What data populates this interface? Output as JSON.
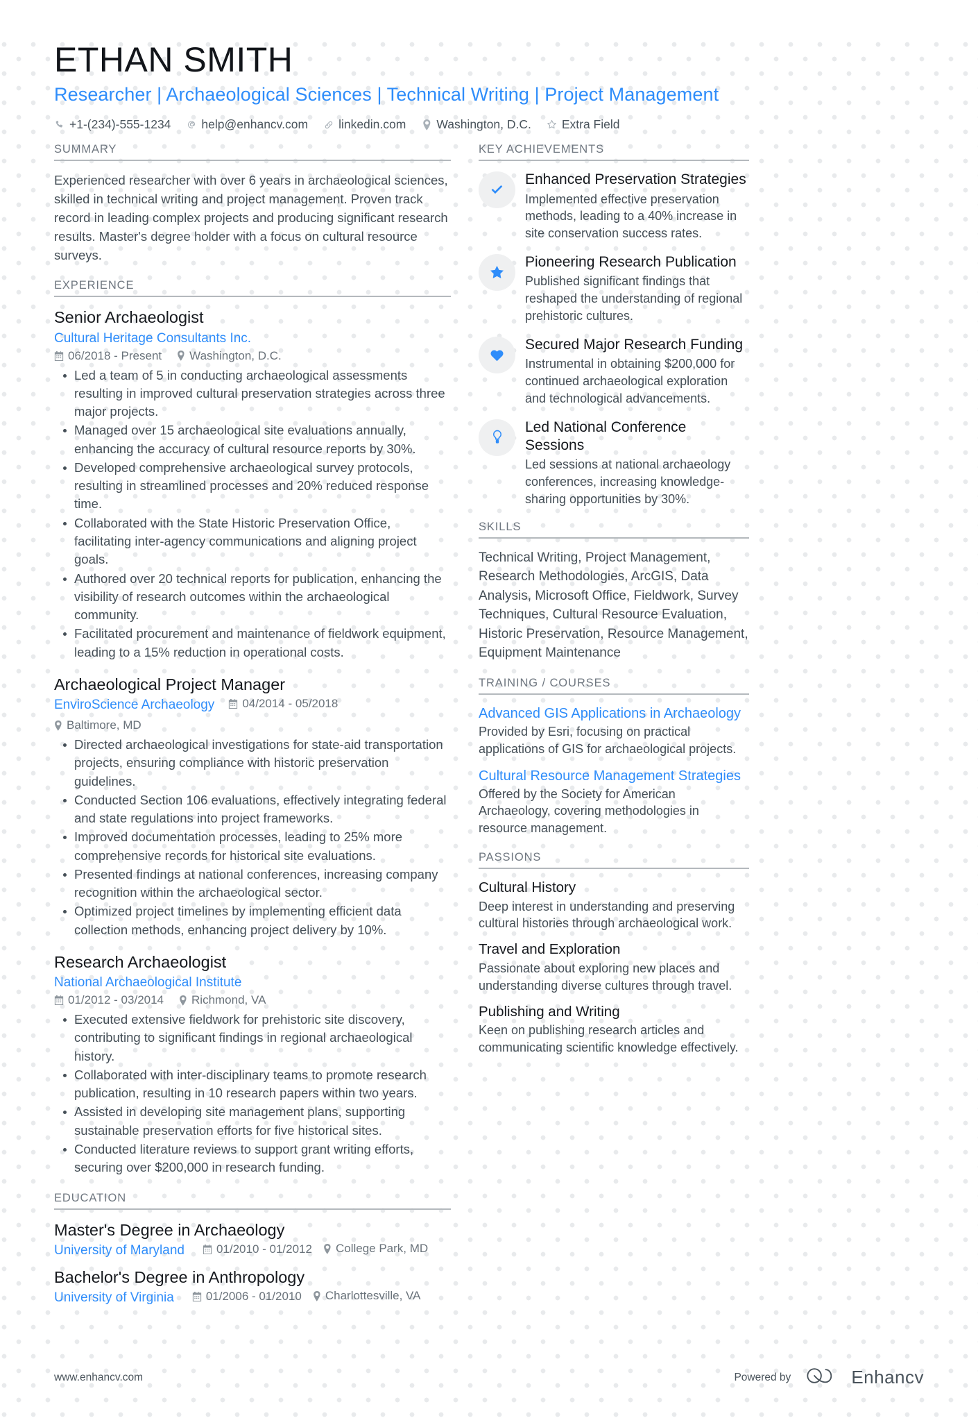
{
  "header": {
    "name": "ETHAN SMITH",
    "headline": "Researcher | Archaeological Sciences | Technical Writing | Project Management",
    "contacts": [
      {
        "icon": "phone-icon",
        "text": "+1-(234)-555-1234"
      },
      {
        "icon": "email-icon",
        "text": "help@enhancv.com"
      },
      {
        "icon": "link-icon",
        "text": "linkedin.com"
      },
      {
        "icon": "location-pin-icon",
        "text": "Washington, D.C."
      },
      {
        "icon": "star-outline-icon",
        "text": "Extra Field"
      }
    ]
  },
  "sections": {
    "summary": {
      "title": "SUMMARY",
      "text": "Experienced researcher with over 6 years in archaeological sciences, skilled in technical writing and project management. Proven track record in leading complex projects and producing significant research results. Master's degree holder with a focus on cultural resource surveys."
    },
    "experience": {
      "title": "EXPERIENCE",
      "jobs": [
        {
          "title": "Senior Archaeologist",
          "company": "Cultural Heritage Consultants Inc.",
          "dates": "06/2018 - Present",
          "location": "Washington, D.C.",
          "inline_meta": false,
          "bullets": [
            "Led a team of 5 in conducting archaeological assessments resulting in improved cultural preservation strategies across three major projects.",
            "Managed over 15 archaeological site evaluations annually, enhancing the accuracy of cultural resource reports by 30%.",
            "Developed comprehensive archaeological survey protocols, resulting in streamlined processes and 20% reduced response time.",
            "Collaborated with the State Historic Preservation Office, facilitating inter-agency communications and aligning project goals.",
            "Authored over 20 technical reports for publication, enhancing the visibility of research outcomes within the archaeological community.",
            "Facilitated procurement and maintenance of fieldwork equipment, leading to a 15% reduction in operational costs."
          ]
        },
        {
          "title": "Archaeological Project Manager",
          "company": "EnviroScience Archaeology",
          "dates": "04/2014 - 05/2018",
          "location": "Baltimore, MD",
          "inline_meta": true,
          "bullets": [
            "Directed archaeological investigations for state-aid transportation projects, ensuring compliance with historic preservation guidelines.",
            "Conducted Section 106 evaluations, effectively integrating federal and state regulations into project frameworks.",
            "Improved documentation processes, leading to 25% more comprehensive records for historical site evaluations.",
            "Presented findings at national conferences, increasing company recognition within the archaeological sector.",
            "Optimized project timelines by implementing efficient data collection methods, enhancing project delivery by 10%."
          ]
        },
        {
          "title": "Research Archaeologist",
          "company": "National Archaeological Institute",
          "dates": "01/2012 - 03/2014",
          "location": "Richmond, VA",
          "inline_meta": false,
          "bullets": [
            "Executed extensive fieldwork for prehistoric site discovery, contributing to significant findings in regional archaeological history.",
            "Collaborated with inter-disciplinary teams to promote research publication, resulting in 10 research papers within two years.",
            "Assisted in developing site management plans, supporting sustainable preservation efforts for five historical sites.",
            "Conducted literature reviews to support grant writing efforts, securing over $200,000 in research funding."
          ]
        }
      ]
    },
    "education": {
      "title": "EDUCATION",
      "items": [
        {
          "degree": "Master's Degree in Archaeology",
          "school": "University of Maryland",
          "dates": "01/2010 - 01/2012",
          "location": "College Park, MD"
        },
        {
          "degree": "Bachelor's Degree in Anthropology",
          "school": "University of Virginia",
          "dates": "01/2006 - 01/2010",
          "location": "Charlottesville, VA"
        }
      ]
    },
    "key_achievements": {
      "title": "KEY ACHIEVEMENTS",
      "items": [
        {
          "icon": "check-icon",
          "title": "Enhanced Preservation Strategies",
          "description": "Implemented effective preservation methods, leading to a 40% increase in site conservation success rates."
        },
        {
          "icon": "star-icon",
          "title": "Pioneering Research Publication",
          "description": "Published significant findings that reshaped the understanding of regional prehistoric cultures."
        },
        {
          "icon": "heart-icon",
          "title": "Secured Major Research Funding",
          "description": "Instrumental in obtaining $200,000 for continued archaeological exploration and technological advancements."
        },
        {
          "icon": "lightbulb-icon",
          "title": "Led National Conference Sessions",
          "description": "Led sessions at national archaeology conferences, increasing knowledge-sharing opportunities by 30%."
        }
      ]
    },
    "skills": {
      "title": "SKILLS",
      "text": "Technical Writing, Project Management, Research Methodologies, ArcGIS, Data Analysis, Microsoft Office, Fieldwork, Survey Techniques, Cultural Resource Evaluation, Historic Preservation, Resource Management, Equipment Maintenance"
    },
    "training": {
      "title": "TRAINING / COURSES",
      "items": [
        {
          "title": "Advanced GIS Applications in Archaeology",
          "description": "Provided by Esri, focusing on practical applications of GIS for archaeological projects."
        },
        {
          "title": "Cultural Resource Management Strategies",
          "description": "Offered by the Society for American Archaeology, covering methodologies in resource management."
        }
      ]
    },
    "passions": {
      "title": "PASSIONS",
      "items": [
        {
          "title": "Cultural History",
          "description": "Deep interest in understanding and preserving cultural histories through archaeological work."
        },
        {
          "title": "Travel and Exploration",
          "description": "Passionate about exploring new places and understanding diverse cultures through travel."
        },
        {
          "title": "Publishing and Writing",
          "description": "Keen on publishing research articles and communicating scientific knowledge effectively."
        }
      ]
    }
  },
  "footer": {
    "url": "www.enhancv.com",
    "powered_by": "Powered by",
    "brand": "Enhancv"
  },
  "colors": {
    "accent": "#2f8dfa",
    "heading": "#16191e",
    "body": "#454f57",
    "muted": "#69727a",
    "rule": "#b4b9bd",
    "badge_bg": "#eff0f1"
  }
}
